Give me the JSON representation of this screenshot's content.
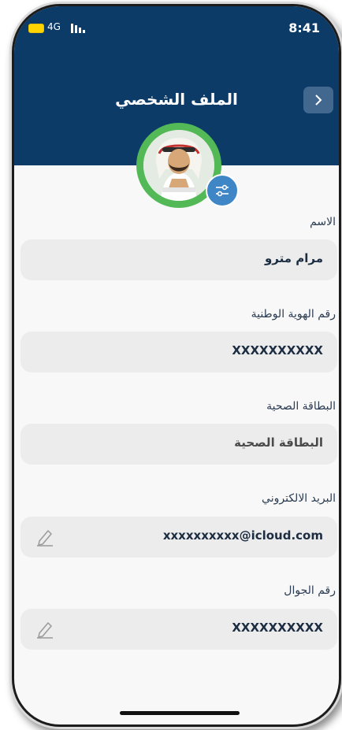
{
  "status_bar": {
    "network": "4G",
    "time": "8:41"
  },
  "header": {
    "title": "الملف الشخصي"
  },
  "fields": [
    {
      "label": "الاسم",
      "value": "مرام مترو"
    },
    {
      "label": "رقم الهوية الوطنية",
      "value": "XXXXXXXXXX"
    },
    {
      "label": "البطاقة الصحية",
      "value": "البطاقة الصحية"
    },
    {
      "label": "البريد الالكتروني",
      "value": "xxxxxxxxxx@icloud.com"
    },
    {
      "label": "رقم الجوال",
      "value": "XXXXXXXXXX"
    }
  ],
  "colors": {
    "header_bg": "#0d3b68",
    "avatar_ring": "#52b956",
    "edit_button": "#3f86c7",
    "field_bg": "#ececec"
  },
  "icons": {
    "back": "chevron-right-icon",
    "edit_photo": "sliders-icon",
    "edit_field": "pencil-icon"
  }
}
